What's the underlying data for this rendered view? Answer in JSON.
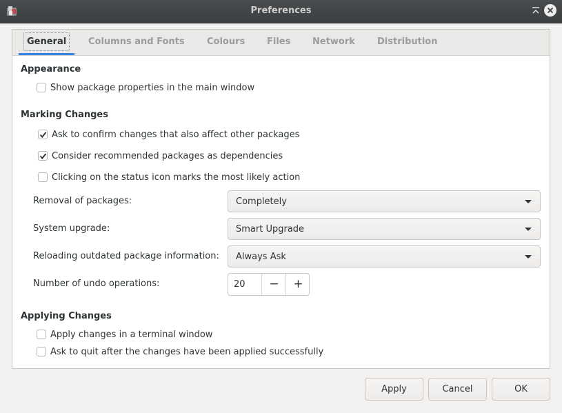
{
  "window": {
    "title": "Preferences"
  },
  "tabs": [
    {
      "label": "General",
      "active": true
    },
    {
      "label": "Columns and Fonts",
      "active": false
    },
    {
      "label": "Colours",
      "active": false
    },
    {
      "label": "Files",
      "active": false
    },
    {
      "label": "Network",
      "active": false
    },
    {
      "label": "Distribution",
      "active": false
    }
  ],
  "appearance": {
    "title": "Appearance",
    "show_properties": {
      "label": "Show package properties in the main window",
      "checked": false
    }
  },
  "marking": {
    "title": "Marking Changes",
    "confirm_changes": {
      "label": "Ask to confirm changes that also affect other packages",
      "checked": true
    },
    "recommended_deps": {
      "label": "Consider recommended packages as dependencies",
      "checked": true
    },
    "status_icon": {
      "label": "Clicking on the status icon marks the most likely action",
      "checked": false
    },
    "removal": {
      "label": "Removal of packages:",
      "value": "Completely"
    },
    "upgrade": {
      "label": "System upgrade:",
      "value": "Smart Upgrade"
    },
    "reloading": {
      "label": "Reloading outdated package information:",
      "value": "Always Ask"
    },
    "undo": {
      "label": "Number of undo operations:",
      "value": "20",
      "minus": "−",
      "plus": "+"
    }
  },
  "applying": {
    "title": "Applying Changes",
    "terminal": {
      "label": "Apply changes in a terminal window",
      "checked": false
    },
    "ask_quit": {
      "label": "Ask to quit after the changes have been applied successfully",
      "checked": false
    }
  },
  "buttons": {
    "apply": "Apply",
    "cancel": "Cancel",
    "ok": "OK"
  },
  "colors": {
    "accent": "#3584e4",
    "titlebar": "#3b3d3f"
  },
  "icons": {
    "app": "package-manager-icon",
    "maximize": "maximize-icon",
    "close": "close-icon"
  }
}
